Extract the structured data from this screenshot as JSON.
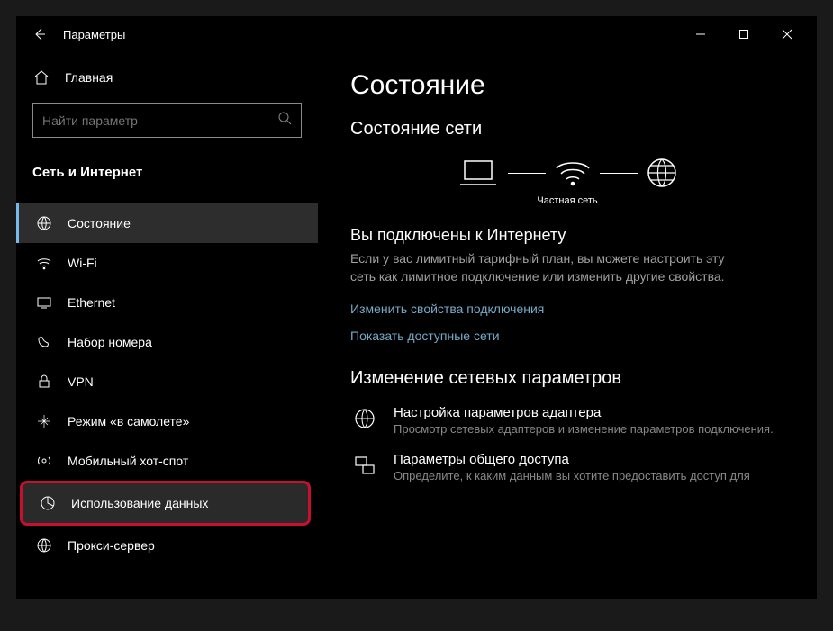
{
  "titlebar": {
    "title": "Параметры"
  },
  "sidebar": {
    "home": "Главная",
    "search_placeholder": "Найти параметр",
    "category": "Сеть и Интернет",
    "items": [
      {
        "label": "Состояние"
      },
      {
        "label": "Wi-Fi"
      },
      {
        "label": "Ethernet"
      },
      {
        "label": "Набор номера"
      },
      {
        "label": "VPN"
      },
      {
        "label": "Режим «в самолете»"
      },
      {
        "label": "Мобильный хот-спот"
      },
      {
        "label": "Использование данных"
      },
      {
        "label": "Прокси-сервер"
      }
    ]
  },
  "main": {
    "title": "Состояние",
    "section1_title": "Состояние сети",
    "net_label": "Частная сеть",
    "connected_title": "Вы подключены к Интернету",
    "connected_desc": "Если у вас лимитный тарифный план, вы можете настроить эту сеть как лимитное подключение или изменить другие свойства.",
    "link1": "Изменить свойства подключения",
    "link2": "Показать доступные сети",
    "section2_title": "Изменение сетевых параметров",
    "opt1_title": "Настройка параметров адаптера",
    "opt1_desc": "Просмотр сетевых адаптеров и изменение параметров подключения.",
    "opt2_title": "Параметры общего доступа",
    "opt2_desc": "Определите, к каким данным вы хотите предоставить доступ для"
  }
}
